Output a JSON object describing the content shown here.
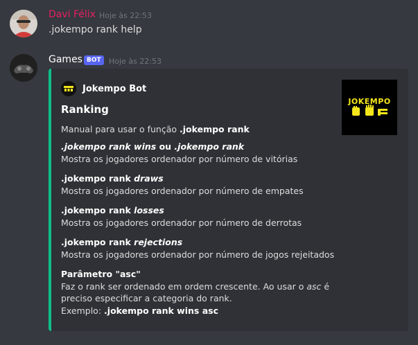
{
  "messages": [
    {
      "author": "Davi Félix",
      "author_color": "#e91e63",
      "timestamp": "Hoje às 22:53",
      "content": ".jokempo rank help"
    },
    {
      "author": "Games",
      "author_color": "#ffffff",
      "bot_tag": "BOT",
      "timestamp": "Hoje às 22:53"
    }
  ],
  "embed": {
    "accent_color": "#0fbf8a",
    "author_name": "Jokempo Bot",
    "thumbnail_text": "JOKEMPO",
    "title": "Ranking",
    "description_prefix": "Manual para usar o função ",
    "description_cmd": ".jokempo rank",
    "fields": [
      {
        "name_parts": [
          ".jokempo rank wins",
          " ou ",
          ".jokempo rank"
        ],
        "value": "Mostra os jogadores ordenador por número de vitórias"
      },
      {
        "name_parts": [
          ".jokempo rank ",
          "draws"
        ],
        "value": "Mostra os jogadores ordenador por número de empates"
      },
      {
        "name_parts": [
          ".jokempo rank ",
          "losses"
        ],
        "value": "Mostra os jogadores ordenador por número de derrotas"
      },
      {
        "name_parts": [
          ".jokempo rank ",
          "rejections"
        ],
        "value": "Mostra os jogadores ordenador por número de jogos rejeitados"
      },
      {
        "name": "Parâmetro \"asc\"",
        "value_line1_a": "Faz o rank ser ordenado em ordem crescente. Ao usar o ",
        "value_line1_em": "asc",
        "value_line1_b": " é",
        "value_line2": "preciso especificar a categoria do rank.",
        "value_line3_a": "Exemplo: ",
        "value_line3_b": ".jokempo rank wins asc"
      }
    ]
  }
}
